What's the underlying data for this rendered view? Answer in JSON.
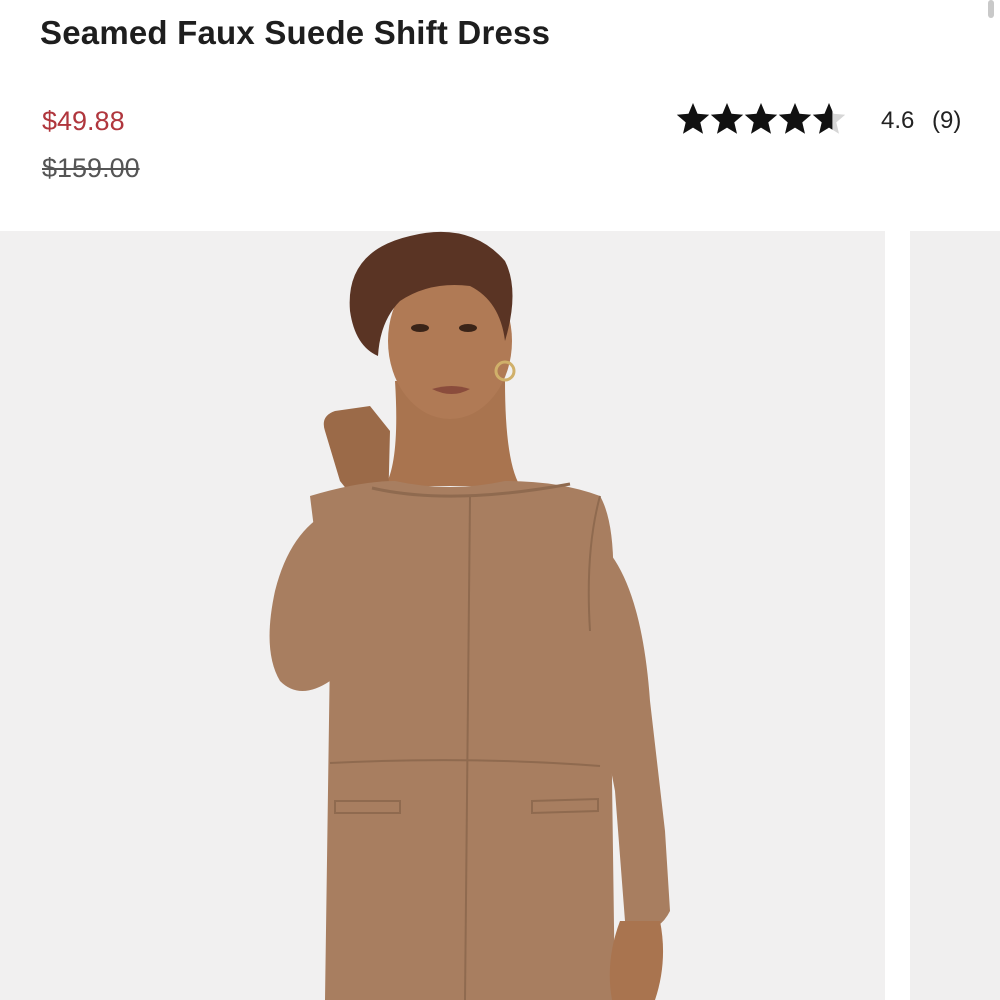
{
  "product": {
    "title": "Seamed Faux Suede Shift Dress",
    "sale_price": "$49.88",
    "original_price": "$159.00",
    "rating": {
      "stars": 4.6,
      "value": "4.6",
      "count": "(9)"
    }
  },
  "gallery": {
    "main_image": "model-wearing-dress-photo",
    "next_image": "next-photo-peek"
  },
  "colors": {
    "sale": "#b0363d",
    "dress": "#a87e60",
    "background": "#f1f0f0"
  }
}
